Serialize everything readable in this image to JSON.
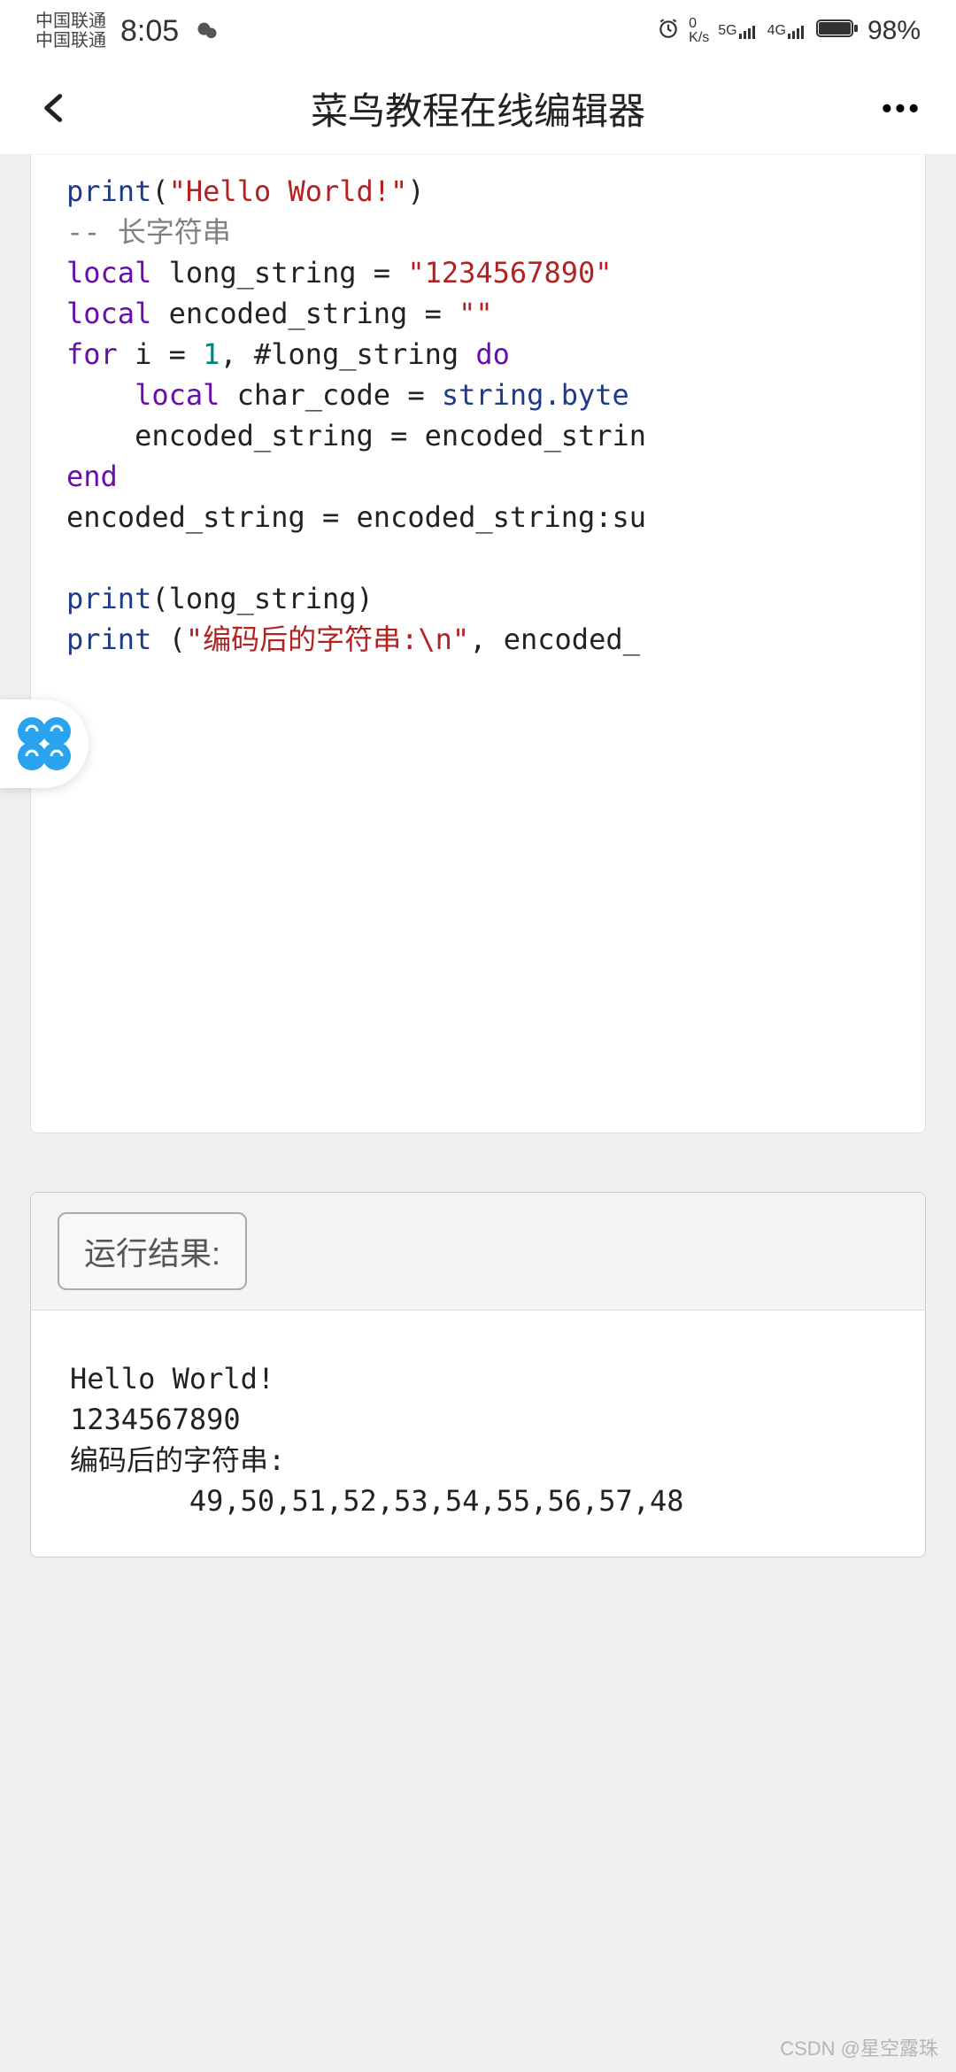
{
  "status": {
    "carrier1": "中国联通",
    "carrier2": "中国联通",
    "time": "8:05",
    "net_speed_top": "0",
    "net_speed_bottom": "K/s",
    "sig1_label": "5G",
    "sig2_label": "4G",
    "battery": "98%"
  },
  "header": {
    "title": "菜鸟教程在线编辑器"
  },
  "code": {
    "line1_fn": "print",
    "line1_paren_open": "(",
    "line1_str": "\"Hello World!\"",
    "line1_paren_close": ")",
    "line2_cmt": "-- 长字符串",
    "line3_kw": "local",
    "line3_var": " long_string = ",
    "line3_str": "\"1234567890\"",
    "line4_kw": "local",
    "line4_var": " encoded_string = ",
    "line4_str": "\"\"",
    "line5_for": "for",
    "line5_mid": " i = ",
    "line5_num": "1",
    "line5_rest": ", #long_string ",
    "line5_do": "do",
    "line6_kw": "local",
    "line6_var": " char_code = ",
    "line6_call": "string.byte",
    "line7_text": "encoded_string = encoded_strin",
    "line8_end": "end",
    "line9_text": "encoded_string = encoded_string:su",
    "line11_fn": "print",
    "line11_rest": "(long_string)",
    "line12_fn": "print",
    "line12_sp": " (",
    "line12_str": "\"编码后的字符串:\\n\"",
    "line12_rest": ", encoded_"
  },
  "results": {
    "label": "运行结果:",
    "out1": "Hello World!",
    "out2": "1234567890",
    "out3": "编码后的字符串:",
    "out4": "       49,50,51,52,53,54,55,56,57,48"
  },
  "watermark": "CSDN @星空露珠"
}
